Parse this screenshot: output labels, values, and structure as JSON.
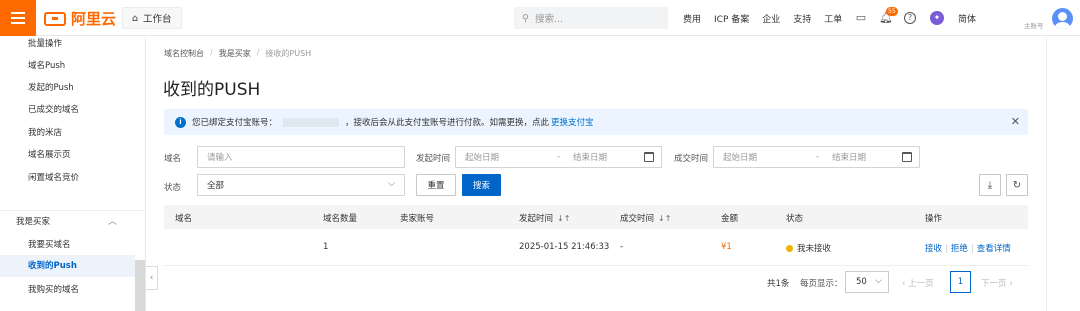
{
  "topbar": {
    "brand": "阿里云",
    "workbench": "工作台",
    "search_placeholder": "搜索...",
    "nav": [
      "费用",
      "ICP 备案",
      "企业",
      "支持",
      "工单"
    ],
    "badge_count": "55",
    "language": "简体",
    "account_label": "主账号"
  },
  "sidebar": {
    "items_top": [
      "批量操作",
      "域名Push",
      "发起的Push",
      "已成交的域名",
      "我的米店",
      "域名展示页",
      "闲置域名竞价"
    ],
    "group_label": "我是买家",
    "items_buyer": [
      "我要买域名",
      "收到的Push",
      "我购买的域名"
    ]
  },
  "breadcrumb": [
    "域名控制台",
    "我是买家",
    "接收的PUSH"
  ],
  "page_title": "收到的PUSH",
  "notice": {
    "text_before": "您已绑定支付宝账号：",
    "text_after": "，接收后会从此支付宝账号进行付款。如需更换，点此",
    "link": "更换支付宝"
  },
  "filters": {
    "domain_label": "域名",
    "domain_placeholder": "请输入",
    "initiated_label": "发起时间",
    "deal_label": "成交时间",
    "start_placeholder": "起始日期",
    "end_placeholder": "结束日期",
    "range_sep": "-",
    "status_label": "状态",
    "status_value": "全部",
    "reset_button": "重置",
    "search_button": "搜索"
  },
  "table": {
    "columns": [
      "域名",
      "域名数量",
      "卖家账号",
      "发起时间",
      "成交时间",
      "金额",
      "状态",
      "操作"
    ],
    "rows": [
      {
        "domain": "",
        "count": "1",
        "seller": "",
        "initiated": "2025-01-15 21:46:33",
        "deal_time": "-",
        "amount": "¥1",
        "status": "我未接收",
        "actions": [
          "接收",
          "拒绝",
          "查看详情"
        ]
      }
    ]
  },
  "pagination": {
    "total": "共1条",
    "page_size_label": "每页显示：",
    "page_size": "50",
    "prev": "上一页",
    "current_page": "1",
    "next": "下一页"
  },
  "colors": {
    "brand": "#ff6a00",
    "primary": "#0064c8",
    "status_pending": "#f0b400"
  }
}
